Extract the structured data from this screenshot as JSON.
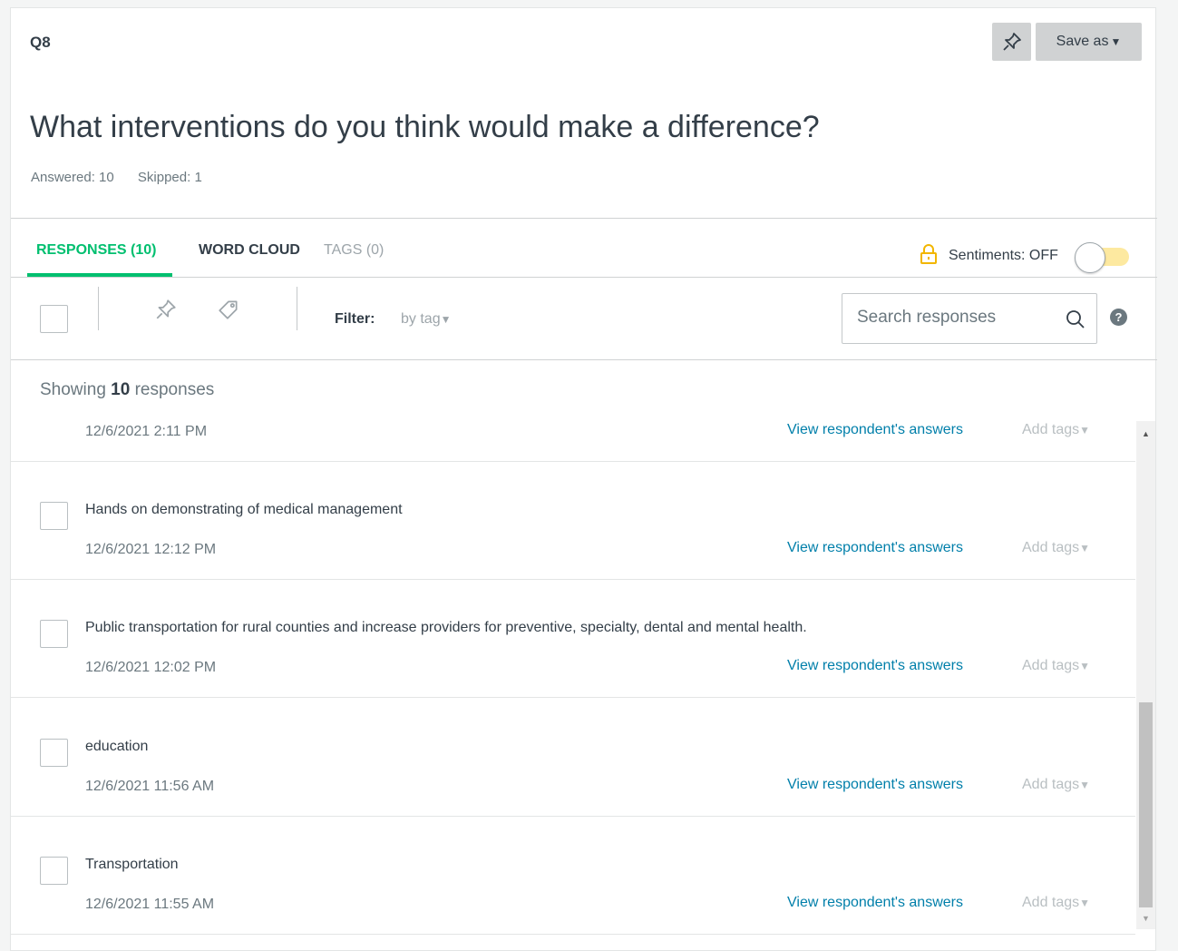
{
  "header": {
    "question_id": "Q8",
    "save_as_label": "Save as",
    "question_title": "What interventions do you think would make a difference?",
    "answered": "Answered: 10",
    "skipped": "Skipped: 1"
  },
  "tabs": [
    {
      "label": "RESPONSES (10)",
      "active": true
    },
    {
      "label": "WORD CLOUD",
      "active": false
    },
    {
      "label": "TAGS (0)",
      "active": false
    }
  ],
  "sentiments": {
    "label": "Sentiments: OFF",
    "enabled": false
  },
  "toolbar": {
    "filter_label": "Filter:",
    "filter_value": "by tag",
    "search_placeholder": "Search responses"
  },
  "showing": {
    "prefix": "Showing",
    "count": "10",
    "suffix": "responses"
  },
  "responses": [
    {
      "text": "",
      "date": "12/6/2021 2:11 PM",
      "view_label": "View respondent's answers",
      "tags_label": "Add tags"
    },
    {
      "text": "Hands on demonstrating of medical management",
      "date": "12/6/2021 12:12 PM",
      "view_label": "View respondent's answers",
      "tags_label": "Add tags"
    },
    {
      "text": "Public transportation for rural counties and increase providers for preventive, specialty, dental and mental health.",
      "date": "12/6/2021 12:02 PM",
      "view_label": "View respondent's answers",
      "tags_label": "Add tags"
    },
    {
      "text": "education",
      "date": "12/6/2021 11:56 AM",
      "view_label": "View respondent's answers",
      "tags_label": "Add tags"
    },
    {
      "text": "Transportation",
      "date": "12/6/2021 11:55 AM",
      "view_label": "View respondent's answers",
      "tags_label": "Add tags"
    }
  ],
  "colors": {
    "accent": "#00bf6f",
    "link": "#007faa",
    "toggle_track": "#fde9a0"
  }
}
